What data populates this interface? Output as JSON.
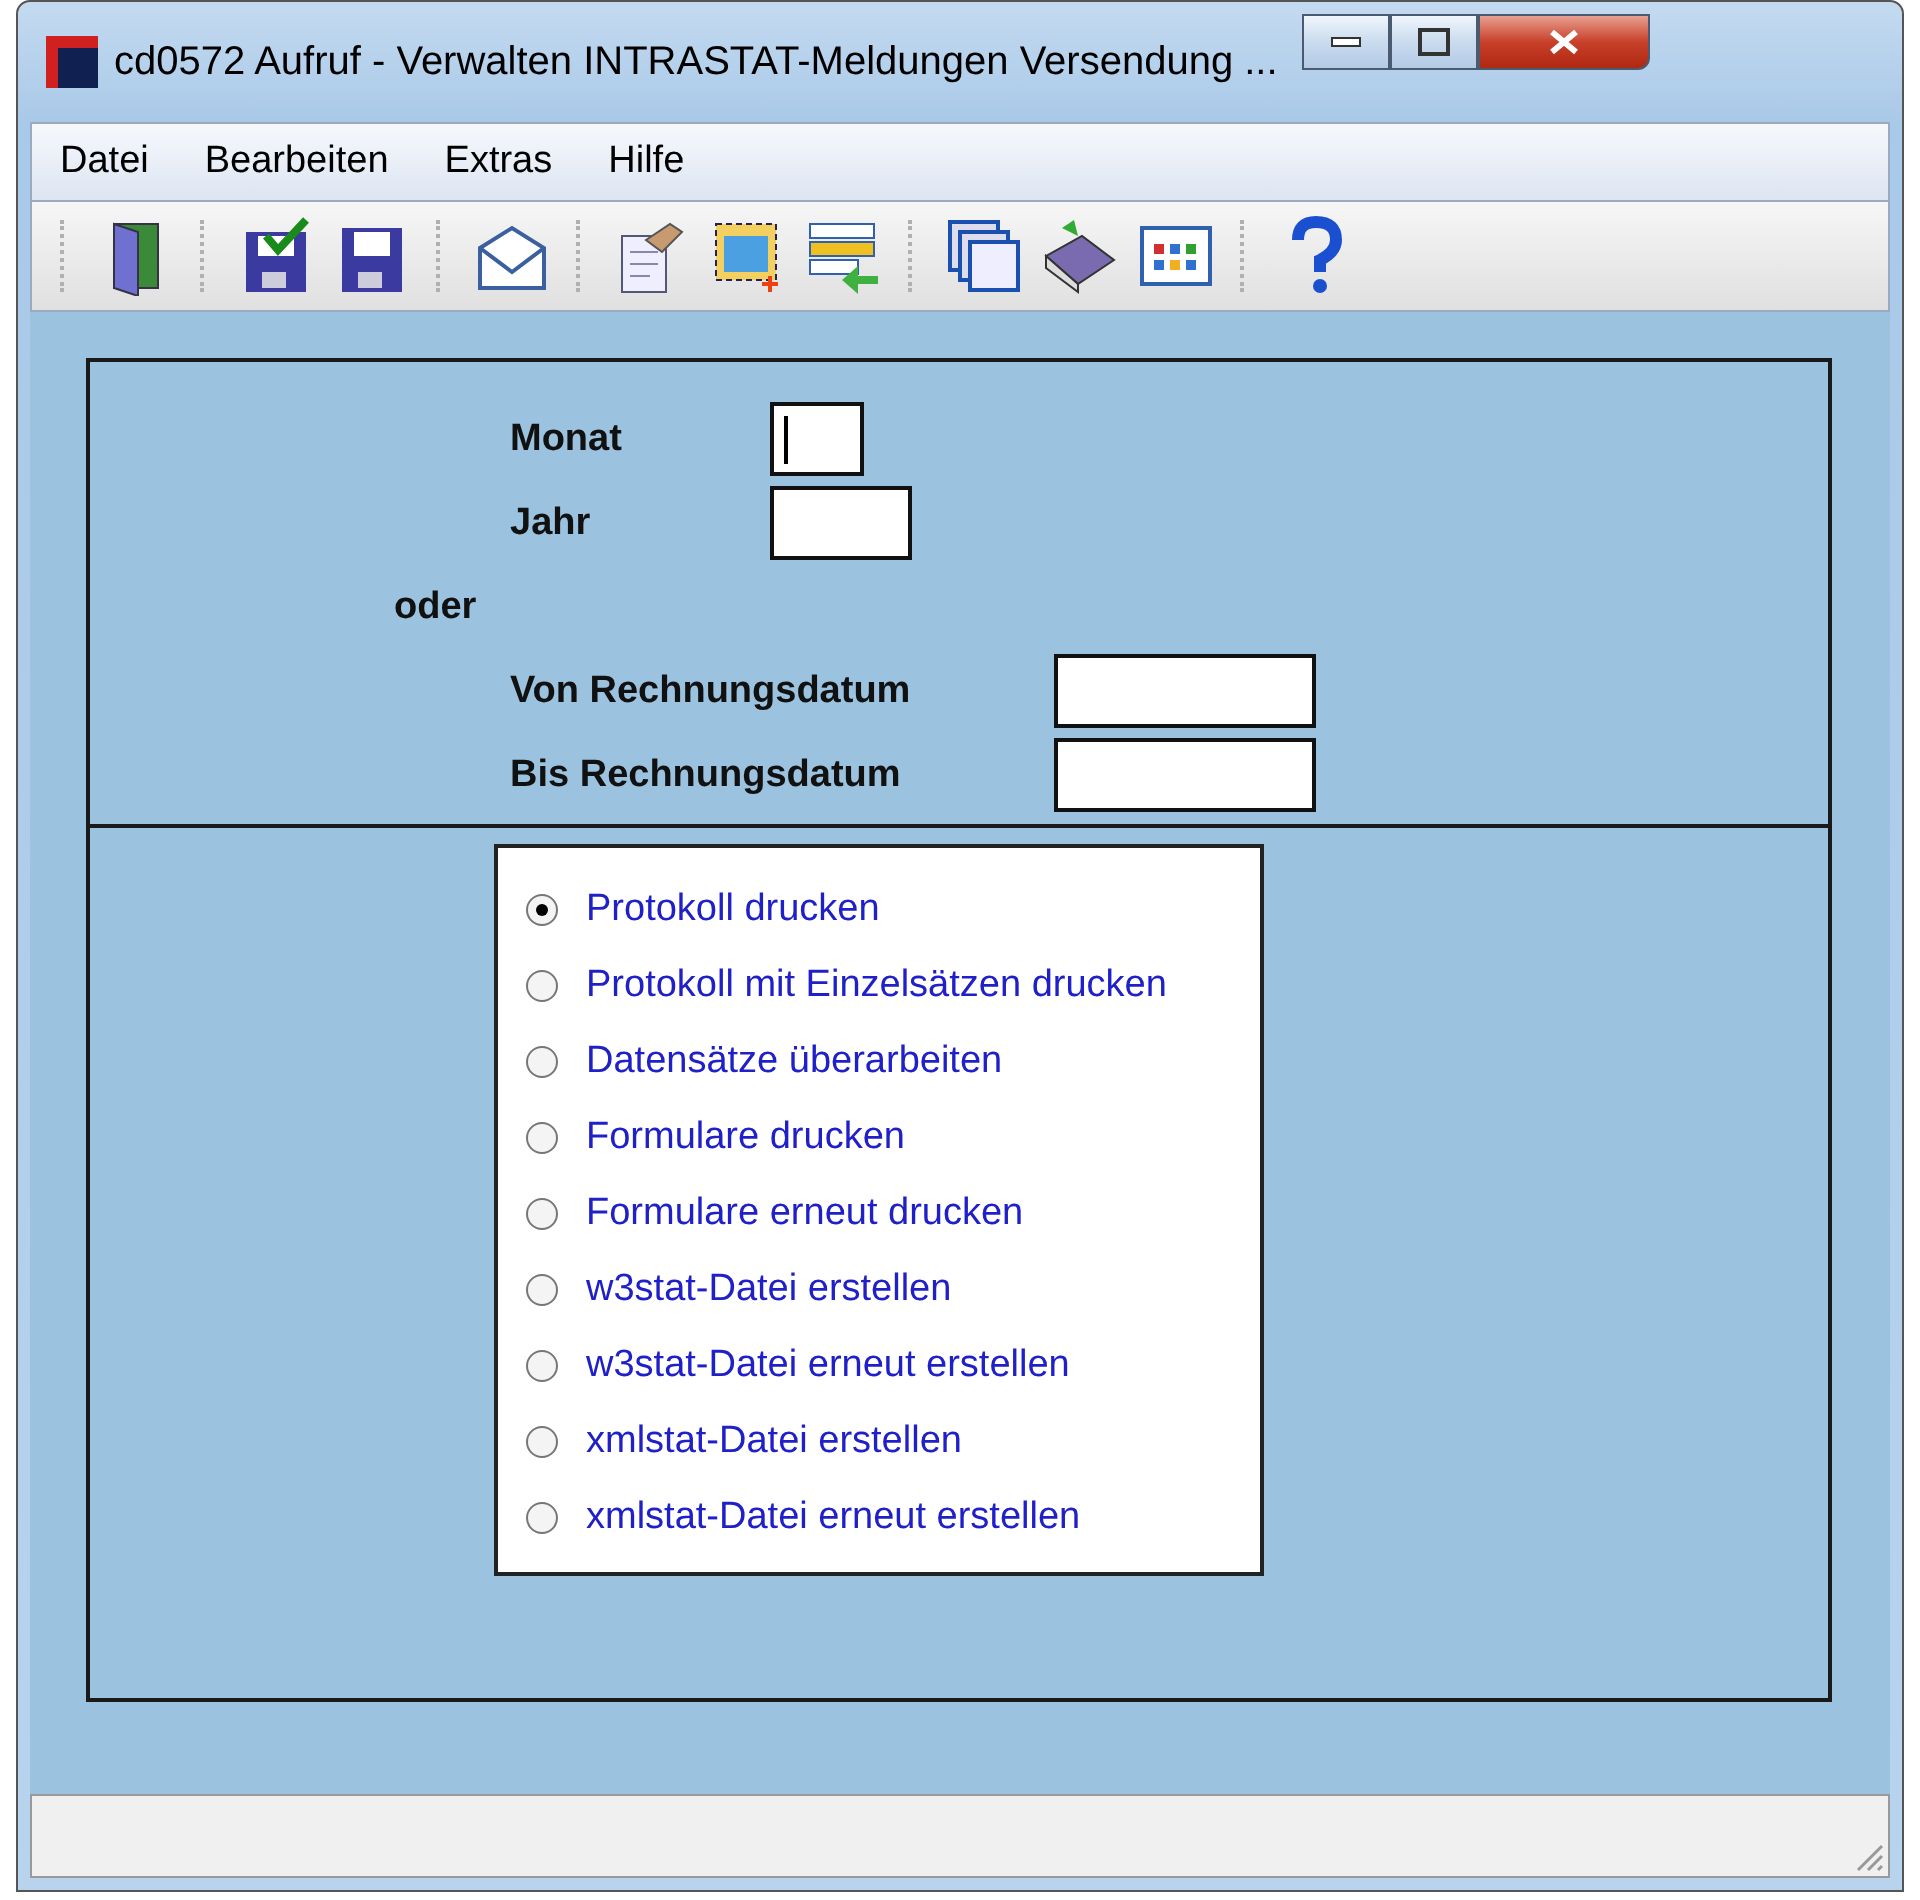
{
  "window": {
    "title": "cd0572 Aufruf - Verwalten INTRASTAT-Meldungen Versendung ..."
  },
  "menu": [
    "Datei",
    "Bearbeiten",
    "Extras",
    "Hilfe"
  ],
  "toolbar": [
    {
      "kind": "sep"
    },
    {
      "kind": "door"
    },
    {
      "kind": "sep"
    },
    {
      "kind": "savecheck"
    },
    {
      "kind": "save"
    },
    {
      "kind": "sep"
    },
    {
      "kind": "mail"
    },
    {
      "kind": "sep"
    },
    {
      "kind": "handdoc"
    },
    {
      "kind": "selectimage"
    },
    {
      "kind": "listarrow"
    },
    {
      "kind": "sep"
    },
    {
      "kind": "windows"
    },
    {
      "kind": "book"
    },
    {
      "kind": "grid"
    },
    {
      "kind": "sep"
    },
    {
      "kind": "help"
    }
  ],
  "fields": [
    {
      "kind": "field",
      "label": "Monat",
      "focused": true
    },
    {
      "kind": "field",
      "label": "Jahr",
      "focused": false
    },
    {
      "kind": "text",
      "label": "oder"
    },
    {
      "kind": "longfield",
      "label": "Von Rechnungsdatum",
      "focused": false
    },
    {
      "kind": "longfield",
      "label": "Bis Rechnungsdatum",
      "focused": false
    }
  ],
  "options": [
    {
      "label": "Protokoll drucken",
      "selected": true
    },
    {
      "label": "Protokoll mit Einzelsätzen drucken",
      "selected": false
    },
    {
      "label": "Datensätze überarbeiten",
      "selected": false
    },
    {
      "label": "Formulare drucken",
      "selected": false
    },
    {
      "label": "Formulare erneut drucken",
      "selected": false
    },
    {
      "label": "w3stat-Datei erstellen",
      "selected": false
    },
    {
      "label": "w3stat-Datei erneut erstellen",
      "selected": false
    },
    {
      "label": "xmlstat-Datei erstellen",
      "selected": false
    },
    {
      "label": "xmlstat-Datei erneut erstellen",
      "selected": false
    }
  ]
}
